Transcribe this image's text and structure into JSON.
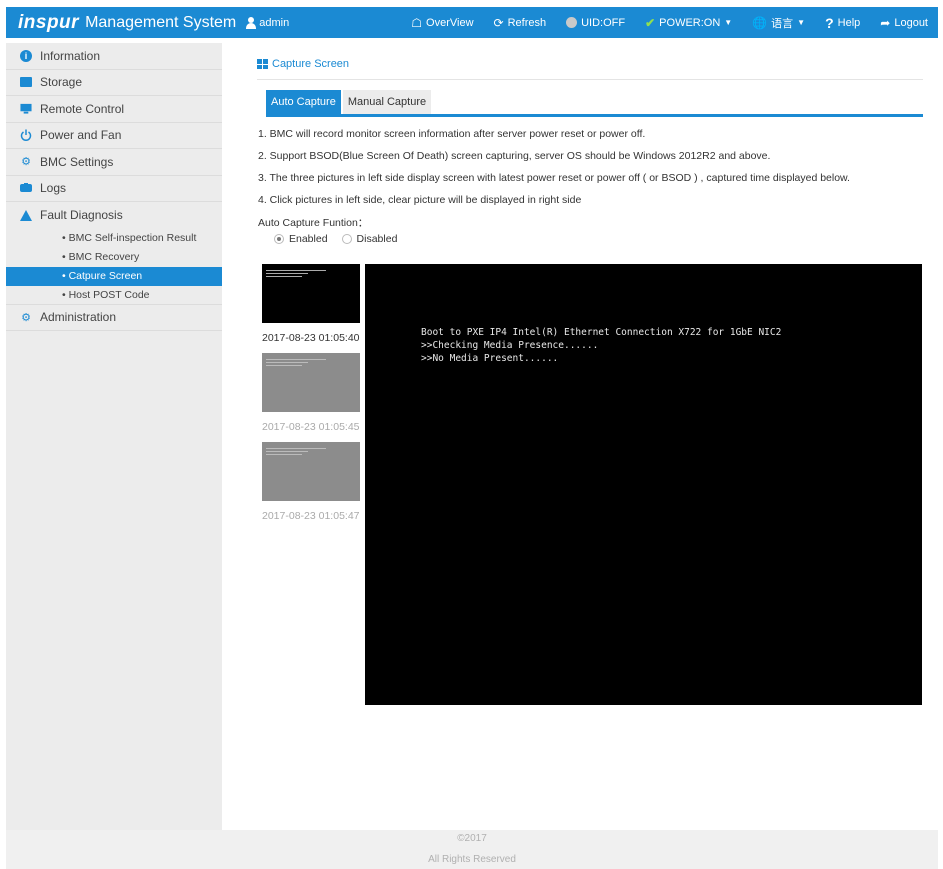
{
  "header": {
    "logo_text": "inspur",
    "app_title": "Management System",
    "user": "admin",
    "nav": {
      "overview": "OverView",
      "refresh": "Refresh",
      "uid": "UID:OFF",
      "power": "POWER:ON",
      "language": "语言",
      "help": "Help",
      "logout": "Logout"
    },
    "colors": {
      "bar": "#1b8ad3",
      "power_ok": "#8fe050",
      "uid_off": "#c9c9c9"
    }
  },
  "sidebar": {
    "items": [
      {
        "label": "Information",
        "icon": "info-icon"
      },
      {
        "label": "Storage",
        "icon": "storage-icon"
      },
      {
        "label": "Remote Control",
        "icon": "monitor-icon"
      },
      {
        "label": "Power and Fan",
        "icon": "power-icon"
      },
      {
        "label": "BMC Settings",
        "icon": "gear-icon"
      },
      {
        "label": "Logs",
        "icon": "logs-icon"
      },
      {
        "label": "Fault Diagnosis",
        "icon": "warning-icon"
      }
    ],
    "sub_items": [
      {
        "label": "• BMC Self-inspection Result"
      },
      {
        "label": "• BMC Recovery"
      },
      {
        "label": "• Catpure Screen",
        "active": true
      },
      {
        "label": "• Host POST Code"
      }
    ],
    "admin": {
      "label": "Administration",
      "icon": "admin-gear-icon"
    }
  },
  "main": {
    "title": "Capture Screen",
    "tabs": [
      {
        "label": "Auto Capture",
        "active": true
      },
      {
        "label": "Manual Capture",
        "active": false
      }
    ],
    "notes": [
      "1. BMC will record monitor screen information after server power reset or power off.",
      "2. Support BSOD(Blue Screen Of Death) screen capturing, server OS should be Windows 2012R2 and above.",
      "3. The three pictures in left side display screen with latest power reset or power off ( or BSOD ) , captured time displayed below.",
      "4. Click pictures in left side, clear picture will be displayed in right side"
    ],
    "auto_capture_label": "Auto Capture Funtion：",
    "radio": {
      "enabled": "Enabled",
      "disabled": "Disabled",
      "selected": "Enabled"
    },
    "thumbnails": [
      {
        "time": "2017-08-23 01:05:40",
        "selected": true
      },
      {
        "time": "2017-08-23 01:05:45",
        "selected": false
      },
      {
        "time": "2017-08-23 01:05:47",
        "selected": false
      }
    ],
    "console_lines": [
      "Boot to PXE IP4 Intel(R) Ethernet Connection X722 for 1GbE NIC2",
      ">>Checking Media Presence......",
      ">>No Media Present......"
    ]
  },
  "footer": {
    "copyright": "©2017",
    "rights": "All Rights Reserved"
  }
}
